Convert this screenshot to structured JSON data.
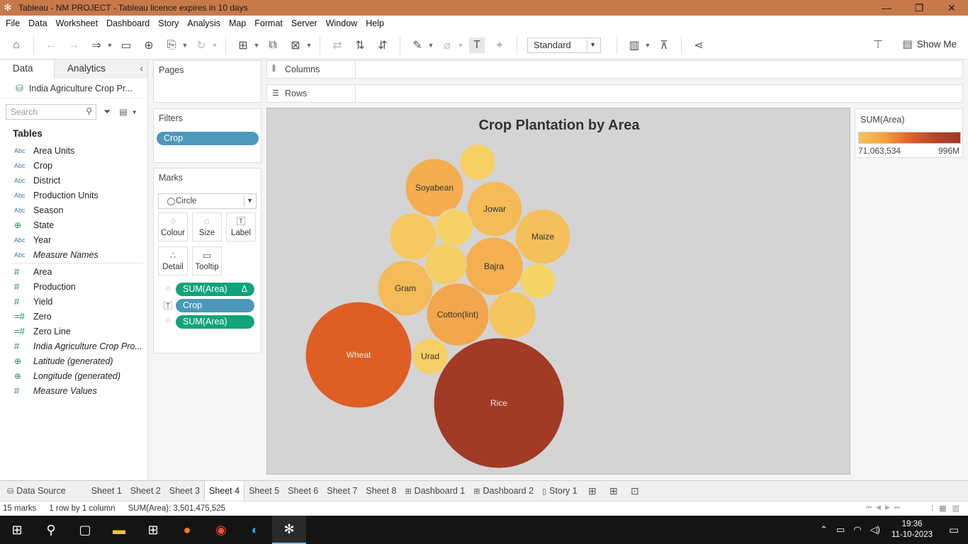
{
  "window": {
    "title": "Tableau - NM PROJECT - Tableau licence expires in 10 days",
    "controls": [
      "—",
      "❐",
      "✕"
    ]
  },
  "menu": [
    "File",
    "Data",
    "Worksheet",
    "Dashboard",
    "Story",
    "Analysis",
    "Map",
    "Format",
    "Server",
    "Window",
    "Help"
  ],
  "toolbar": {
    "fit_select": "Standard",
    "show_me": "Show Me"
  },
  "data_pane": {
    "tab_data": "Data",
    "tab_analytics": "Analytics",
    "datasource": "India Agriculture Crop Pr...",
    "search_placeholder": "Search",
    "tables_heading": "Tables",
    "dimensions": [
      {
        "type": "Abc",
        "name": "Area Units",
        "italic": false
      },
      {
        "type": "Abc",
        "name": "Crop",
        "italic": false
      },
      {
        "type": "Abc",
        "name": "District",
        "italic": false
      },
      {
        "type": "Abc",
        "name": "Production Units",
        "italic": false
      },
      {
        "type": "Abc",
        "name": "Season",
        "italic": false
      },
      {
        "type": "globe",
        "name": "State",
        "italic": false
      },
      {
        "type": "Abc",
        "name": "Year",
        "italic": false
      },
      {
        "type": "Abc",
        "name": "Measure Names",
        "italic": true
      }
    ],
    "measures": [
      {
        "type": "#",
        "name": "Area",
        "italic": false
      },
      {
        "type": "#",
        "name": "Production",
        "italic": false
      },
      {
        "type": "#",
        "name": "Yield",
        "italic": false
      },
      {
        "type": "=#",
        "name": "Zero",
        "italic": false
      },
      {
        "type": "=#",
        "name": "Zero Line",
        "italic": false
      },
      {
        "type": "#",
        "name": "India Agriculture Crop Pro...",
        "italic": true
      },
      {
        "type": "globe",
        "name": "Latitude (generated)",
        "italic": true
      },
      {
        "type": "globe",
        "name": "Longitude (generated)",
        "italic": true
      },
      {
        "type": "#",
        "name": "Measure Values",
        "italic": true
      }
    ]
  },
  "cards": {
    "pages": "Pages",
    "filters": "Filters",
    "filter_pill": "Crop",
    "marks": "Marks",
    "mark_type": "Circle",
    "buttons": {
      "colour": "Colour",
      "size": "Size",
      "label": "Label",
      "detail": "Detail",
      "tooltip": "Tooltip"
    },
    "mark_pills": [
      {
        "icon": "size-icon",
        "label": "SUM(Area)",
        "extra": "Δ",
        "color": "green"
      },
      {
        "icon": "label-icon",
        "label": "Crop",
        "extra": "",
        "color": "blue"
      },
      {
        "icon": "colour-icon",
        "label": "SUM(Area)",
        "extra": "",
        "color": "green"
      }
    ]
  },
  "shelves": {
    "columns": "Columns",
    "rows": "Rows"
  },
  "legend": {
    "title": "SUM(Area)",
    "min": "71,063,534",
    "max": "996M",
    "colors": [
      "#f5c35a",
      "#9e3a28"
    ]
  },
  "chart_data": {
    "type": "packed_bubble",
    "title": "Crop Plantation by Area",
    "measure": "SUM(Area)",
    "bubbles": [
      {
        "label": "Rice",
        "value": 996000000,
        "color": "#a23a26"
      },
      {
        "label": "Wheat",
        "value": 660000000,
        "color": "#de5e23"
      },
      {
        "label": "Cotton(lint)",
        "value": 230000000,
        "color": "#f3a74c"
      },
      {
        "label": "Soyabean",
        "value": 200000000,
        "color": "#f4ae50"
      },
      {
        "label": "Bajra",
        "value": 200000000,
        "color": "#f4b050"
      },
      {
        "label": "Gram",
        "value": 180000000,
        "color": "#f4bb58"
      },
      {
        "label": "Jowar",
        "value": 175000000,
        "color": "#f4bb57"
      },
      {
        "label": "Maize",
        "value": 175000000,
        "color": "#f5c05a"
      },
      {
        "label": "",
        "value": 130000000,
        "color": "#f6c960"
      },
      {
        "label": "",
        "value": 130000000,
        "color": "#f5c65d"
      },
      {
        "label": "",
        "value": 100000000,
        "color": "#f6cf64"
      },
      {
        "label": "",
        "value": 80000000,
        "color": "#f6d266"
      },
      {
        "label": "Urad",
        "value": 75000000,
        "color": "#f6d065"
      },
      {
        "label": "",
        "value": 75000000,
        "color": "#f6d063"
      },
      {
        "label": "",
        "value": 71063534,
        "color": "#f6d466"
      }
    ]
  },
  "sheet_tabs": {
    "data_source": "Data Source",
    "sheets": [
      "Sheet 1",
      "Sheet 2",
      "Sheet 3",
      "Sheet 4",
      "Sheet 5",
      "Sheet 6",
      "Sheet 7",
      "Sheet 8"
    ],
    "active": "Sheet 4",
    "dashboards": [
      "Dashboard 1",
      "Dashboard 2"
    ],
    "stories": [
      "Story 1"
    ]
  },
  "status": {
    "marks": "15 marks",
    "rows_cols": "1 row  by  1 column",
    "sum": "SUM(Area): 3,501,475,525"
  },
  "taskbar": {
    "time": "19:36",
    "date": "11-10-2023"
  }
}
